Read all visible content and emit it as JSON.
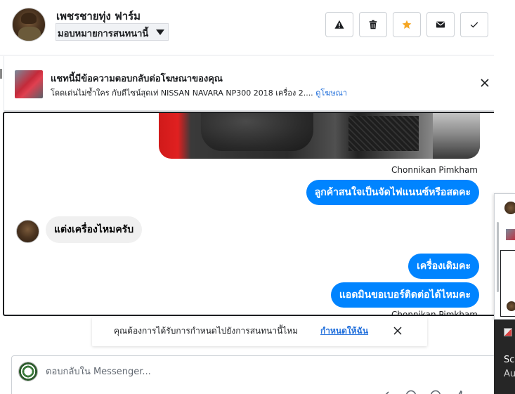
{
  "header": {
    "contact_name": "เพชรชายทุ่ง ฟาร์ม",
    "assign_label": "มอบหมายการสนทนานี้",
    "actions": [
      "spam-icon",
      "delete-icon",
      "star-icon",
      "mark-unread-icon",
      "mark-done-icon"
    ]
  },
  "ad_banner": {
    "title": "แชทนี้มีข้อความตอบกลับต่อโฆษณาของคุณ",
    "subtitle": "โดดเด่นไม่ซ้ำใคร กับดีไซน์สุดเท่ NISSAN NAVARA NP300 2018 เครื่อง 2....",
    "link": "ดูโฆษณา"
  },
  "messages": [
    {
      "type": "outgoing",
      "sender": "Chonnikan Pimkham",
      "text": "ลูกค้าสนใจเป็นจัดไฟแนนซ์หรือสดคะ"
    },
    {
      "type": "incoming",
      "text": "แต่งเครื่องไหมครับ"
    },
    {
      "type": "outgoing",
      "text": "เครื่องเดิมคะ"
    },
    {
      "type": "outgoing",
      "text": "แอดมินขอเบอร์ติดต่อได้ไหมคะ"
    },
    {
      "type": "sender",
      "text": "Chonnikan Pimkham"
    }
  ],
  "assign_prompt": {
    "text": "คุณต้องการได้รับการกำหนดไปยังการสนทนานี้ไหม",
    "link": "กำหนดให้ฉัน"
  },
  "composer": {
    "placeholder": "ตอบกลับใน Messenger..."
  },
  "notification": {
    "title": "Sc",
    "subtitle": "Au"
  },
  "colors": {
    "accent": "#0084ff",
    "link": "#216fdb",
    "star": "#f5a623"
  }
}
